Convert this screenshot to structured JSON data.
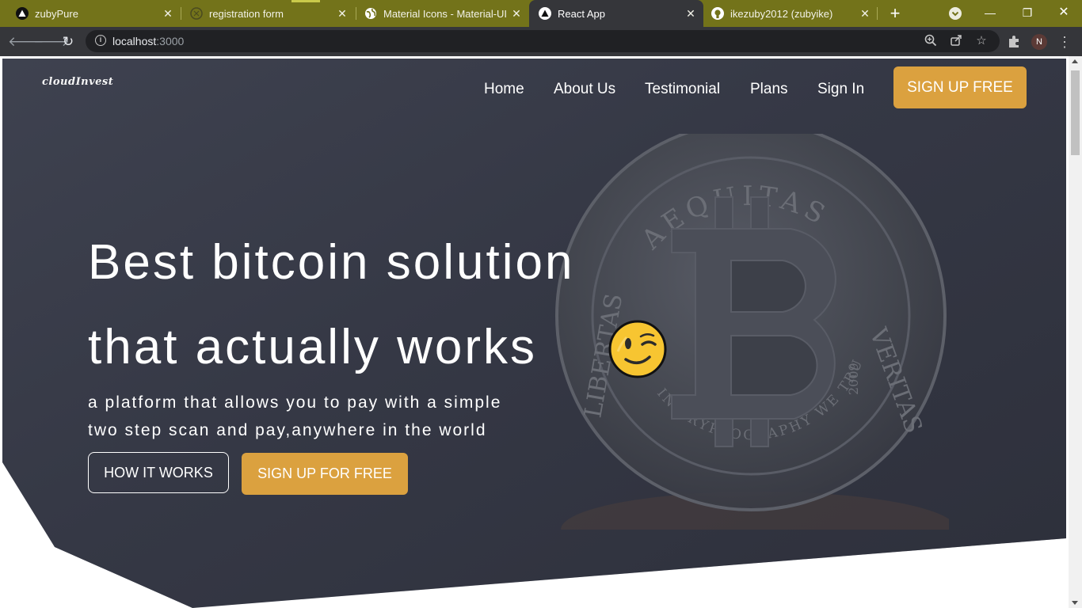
{
  "browser": {
    "tabs": [
      {
        "title": "zubyPure",
        "icon": "triangle-logo-icon",
        "active": false
      },
      {
        "title": "registration form",
        "icon": "compass-icon",
        "active": false
      },
      {
        "title": "Material Icons - Material-UI",
        "icon": "globe-icon",
        "active": false
      },
      {
        "title": "React App",
        "icon": "triangle-logo-icon",
        "active": true
      },
      {
        "title": "ikezuby2012 (zubyike)",
        "icon": "github-icon",
        "active": false
      }
    ],
    "address": {
      "host": "localhost",
      "port": ":3000"
    },
    "profile_initial": "N",
    "colors": {
      "tabstrip": "#73731a",
      "toolbar": "#35363a"
    }
  },
  "site": {
    "logo": "cloudInvest",
    "nav": [
      {
        "label": "Home"
      },
      {
        "label": "About Us"
      },
      {
        "label": "Testimonial"
      },
      {
        "label": "Plans"
      },
      {
        "label": "Sign In"
      }
    ],
    "signup_top_label": "SIGN UP FREE",
    "hero": {
      "headline_line1": "Best bitcoin solution",
      "headline_line2": "that actually works",
      "emoji": "winking-face",
      "subtext_line1": "a platform that allows you to pay with a simple",
      "subtext_line2": "two step scan and pay,anywhere in the world",
      "how_it_works_label": "HOW IT WORKS",
      "signup_label": "SIGN UP FOR FREE",
      "coin": {
        "top_text": "AEQUITAS",
        "right_text": "VERITAS",
        "left_text": "LIBERTAS",
        "bottom_text": "IN CRYPTOGRAPHY WE TRUST",
        "year": "2009"
      }
    },
    "colors": {
      "hero_bg": "#353845",
      "accent": "#dba13f",
      "text": "#ffffff"
    }
  }
}
